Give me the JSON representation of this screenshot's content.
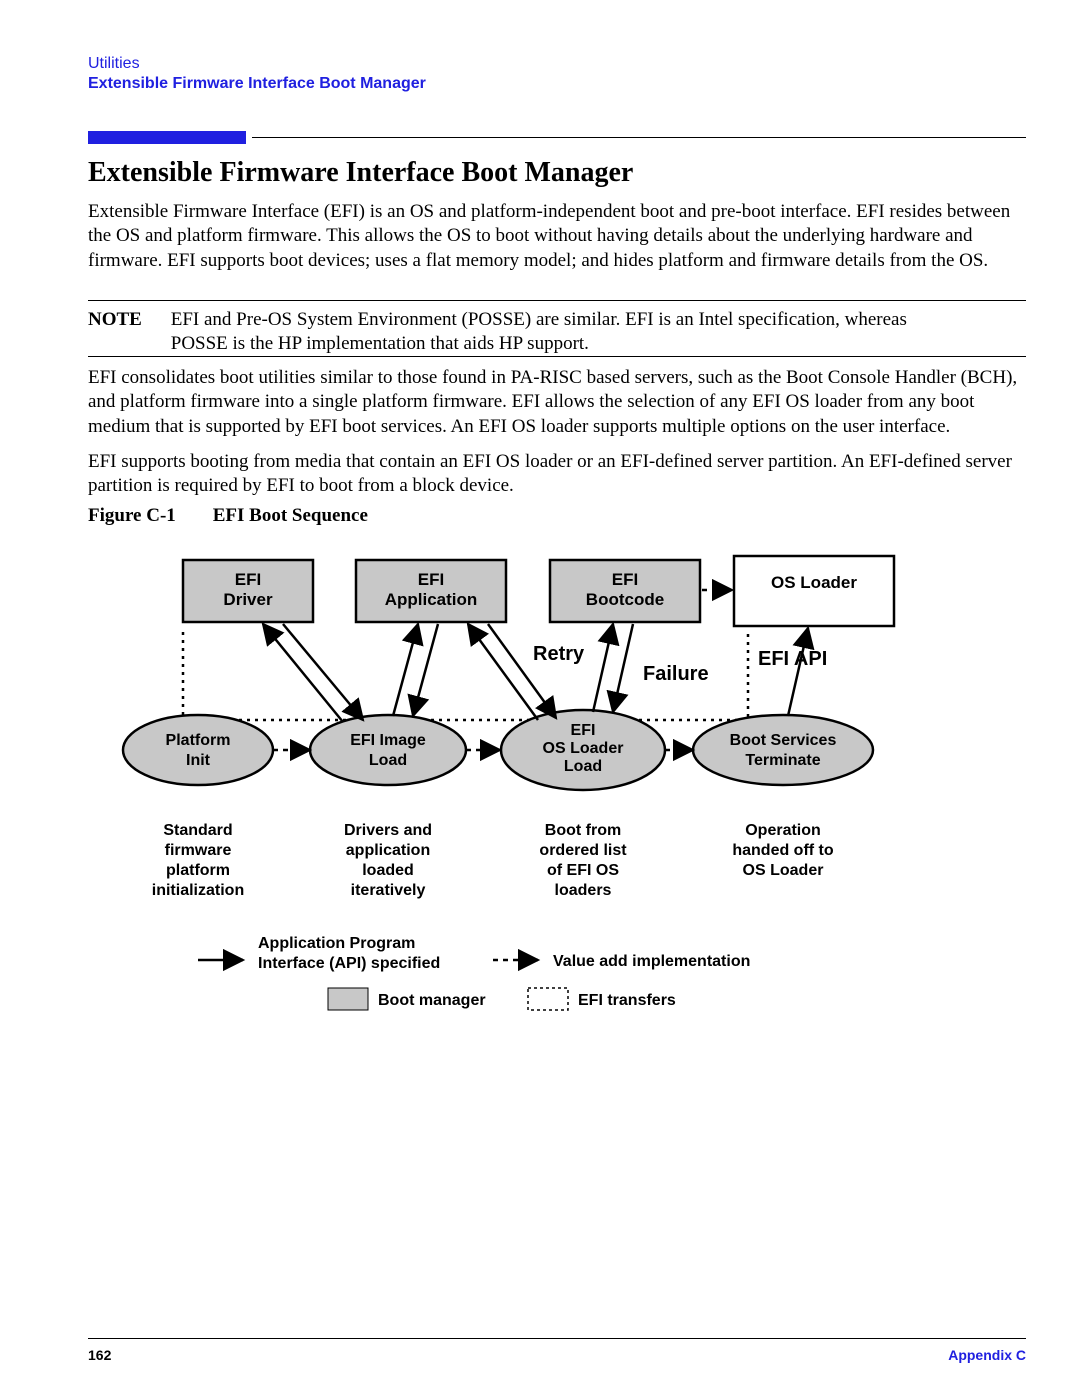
{
  "header": {
    "category": "Utilities",
    "subtitle": "Extensible Firmware Interface Boot Manager"
  },
  "title": "Extensible Firmware Interface Boot Manager",
  "paragraphs": {
    "p1": "Extensible Firmware Interface (EFI) is an OS and platform-independent boot and pre-boot interface. EFI resides between the OS and platform firmware. This allows the OS to boot without having details about the underlying hardware and firmware. EFI supports boot devices; uses a flat memory model; and hides platform and firmware details from the OS.",
    "note_label": "NOTE",
    "note_body": "EFI and Pre-OS System Environment (POSSE) are similar. EFI is an Intel specification, whereas POSSE is the HP implementation that aids HP support.",
    "p2": "EFI consolidates boot utilities similar to those found in PA-RISC based servers, such as the Boot Console Handler (BCH), and platform firmware into a single platform firmware. EFI allows the selection of any EFI OS loader from any boot medium that is supported by EFI boot services. An EFI OS loader supports multiple options on the user interface.",
    "p3": "EFI supports booting from media that contain an EFI OS loader or an EFI-defined server partition. An EFI-defined server partition is required by EFI to boot from a block device."
  },
  "figure": {
    "label": "Figure C-1",
    "title": "EFI Boot Sequence",
    "boxes": {
      "driver_l1": "EFI",
      "driver_l2": "Driver",
      "app_l1": "EFI",
      "app_l2": "Application",
      "boot_l1": "EFI",
      "boot_l2": "Bootcode",
      "osloader": "OS Loader"
    },
    "ellipses": {
      "plat_l1": "Platform",
      "plat_l2": "Init",
      "img_l1": "EFI Image",
      "img_l2": "Load",
      "osl_l1": "EFI",
      "osl_l2": "OS Loader",
      "osl_l3": "Load",
      "term_l1": "Boot Services",
      "term_l2": "Terminate"
    },
    "annotations": {
      "retry": "Retry",
      "failure": "Failure",
      "efi_api": "EFI API"
    },
    "captions": {
      "c1_l1": "Standard",
      "c1_l2": "firmware",
      "c1_l3": "platform",
      "c1_l4": "initialization",
      "c2_l1": "Drivers and",
      "c2_l2": "application",
      "c2_l3": "loaded",
      "c2_l4": "iteratively",
      "c3_l1": "Boot from",
      "c3_l2": "ordered list",
      "c3_l3": "of EFI OS",
      "c3_l4": "loaders",
      "c4_l1": "Operation",
      "c4_l2": "handed off to",
      "c4_l3": "OS Loader"
    },
    "legend": {
      "api_l1": "Application Program",
      "api_l2": "Interface (API) specified",
      "value_add": "Value add implementation",
      "boot_mgr": "Boot manager",
      "efi_trans": "EFI transfers"
    }
  },
  "footer": {
    "page": "162",
    "section": "Appendix C"
  },
  "chart_data": {
    "type": "diagram",
    "title": "EFI Boot Sequence",
    "nodes": [
      {
        "id": "platform_init",
        "shape": "ellipse",
        "label": "Platform Init",
        "caption": "Standard firmware platform initialization",
        "group": "boot_manager"
      },
      {
        "id": "efi_image_load",
        "shape": "ellipse",
        "label": "EFI Image Load",
        "caption": "Drivers and application loaded iteratively",
        "group": "boot_manager"
      },
      {
        "id": "efi_os_loader_load",
        "shape": "ellipse",
        "label": "EFI OS Loader Load",
        "caption": "Boot from ordered list of EFI OS loaders",
        "group": "boot_manager"
      },
      {
        "id": "boot_services_terminate",
        "shape": "ellipse",
        "label": "Boot Services Terminate",
        "caption": "Operation handed off to OS Loader",
        "group": "boot_manager"
      },
      {
        "id": "efi_driver",
        "shape": "rect",
        "label": "EFI Driver",
        "group": "efi_transfer"
      },
      {
        "id": "efi_application",
        "shape": "rect",
        "label": "EFI Application",
        "group": "efi_transfer"
      },
      {
        "id": "efi_bootcode",
        "shape": "rect",
        "label": "EFI Bootcode",
        "group": "efi_transfer"
      },
      {
        "id": "os_loader",
        "shape": "rect",
        "label": "OS Loader",
        "group": "none"
      }
    ],
    "edges": [
      {
        "from": "platform_init",
        "to": "efi_image_load",
        "style": "dashed",
        "kind": "value_add"
      },
      {
        "from": "efi_image_load",
        "to": "efi_os_loader_load",
        "style": "dashed",
        "kind": "value_add"
      },
      {
        "from": "efi_os_loader_load",
        "to": "boot_services_terminate",
        "style": "dashed",
        "kind": "value_add",
        "label": "EFI API"
      },
      {
        "from": "efi_image_load",
        "to": "efi_driver",
        "style": "solid",
        "kind": "api",
        "bidirectional": true
      },
      {
        "from": "efi_image_load",
        "to": "efi_application",
        "style": "solid",
        "kind": "api",
        "bidirectional": true
      },
      {
        "from": "efi_os_loader_load",
        "to": "efi_application",
        "style": "solid",
        "kind": "api",
        "label": "Retry"
      },
      {
        "from": "efi_os_loader_load",
        "to": "efi_bootcode",
        "style": "solid",
        "kind": "api",
        "bidirectional": true
      },
      {
        "from": "efi_os_loader_load",
        "to": "efi_image_load",
        "style": "solid",
        "kind": "api",
        "label": "Failure"
      },
      {
        "from": "efi_bootcode",
        "to": "os_loader",
        "style": "dashed",
        "kind": "value_add"
      },
      {
        "from": "boot_services_terminate",
        "to": "os_loader",
        "style": "solid",
        "kind": "api"
      }
    ],
    "legend": {
      "solid_arrow": "Application Program Interface (API) specified",
      "dashed_arrow": "Value add implementation",
      "ellipse_fill": "Boot manager",
      "rect_dashed": "EFI transfers"
    }
  }
}
